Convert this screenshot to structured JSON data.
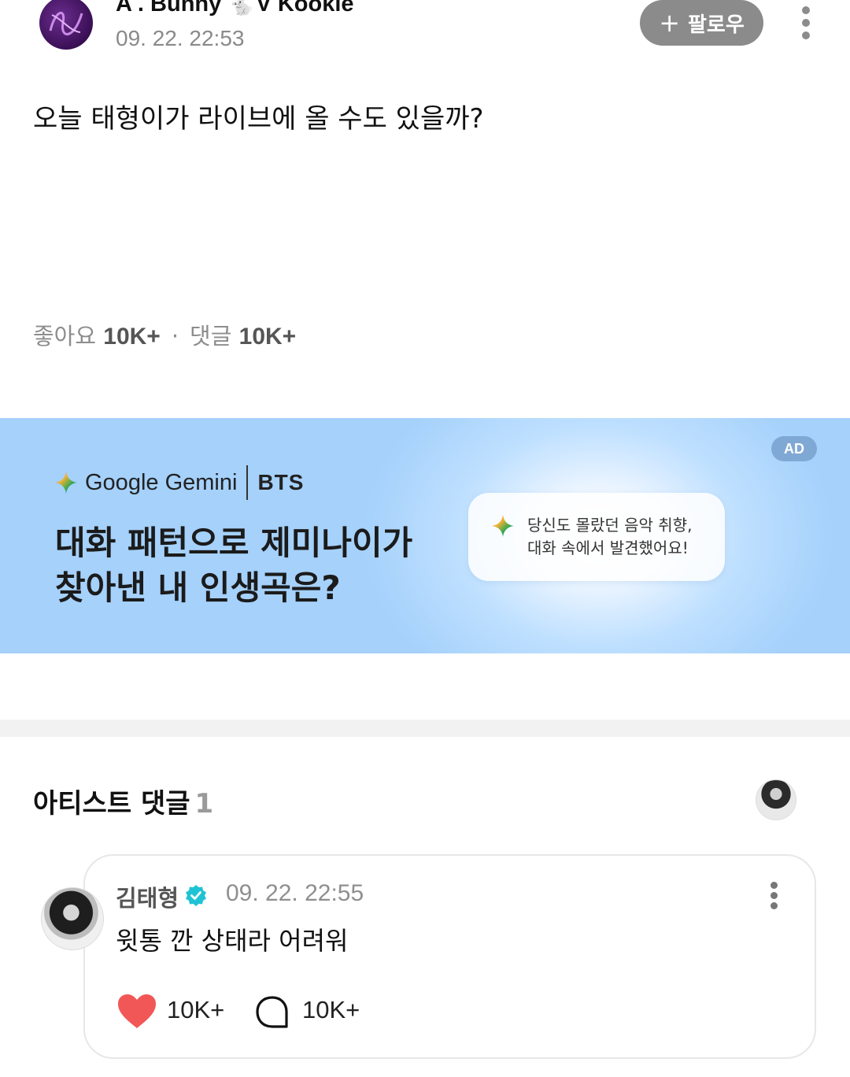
{
  "post": {
    "author_name": "A . Bunny 🐇V Kookie",
    "timestamp": "09. 22. 22:53",
    "follow_label": "팔로우",
    "text": "오늘 태형이가 라이브에 올 수도 있을까?",
    "likes_label": "좋아요",
    "likes_count": "10K+",
    "stats_separator": "·",
    "comments_label": "댓글",
    "comments_count": "10K+"
  },
  "ad": {
    "badge": "AD",
    "brand": "Google Gemini",
    "partner": "BTS",
    "headline_line1": "대화 패턴으로 제미나이가",
    "headline_line2": "찾아낸 내 인생곡은?",
    "bubble_line1": "당신도 몰랐던 음악 취향,",
    "bubble_line2": "대화 속에서 발견했어요!"
  },
  "artist_comments": {
    "title": "아티스트 댓글",
    "count": "1",
    "comment": {
      "name": "김태형",
      "timestamp": "09. 22. 22:55",
      "text": "윗통 깐 상태라 어려워",
      "likes": "10K+",
      "replies": "10K+"
    }
  },
  "icons": {
    "menu": "more-vertical-icon",
    "like": "heart-icon",
    "reply": "speech-bubble-icon",
    "verified": "verified-badge-icon",
    "gemini": "gemini-sparkle-icon"
  },
  "colors": {
    "like": "#f25757",
    "verified": "#1fc3d4",
    "follow_bg": "#8b8b8b",
    "ad_bg": "#a5d1fb"
  }
}
